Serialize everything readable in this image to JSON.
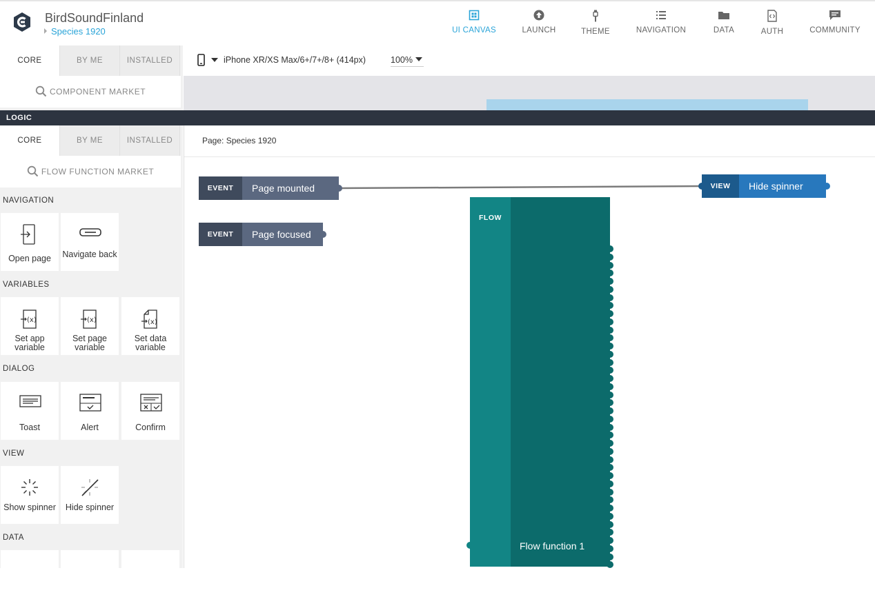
{
  "header": {
    "app_name": "BirdSoundFinland",
    "page_name": "Species 1920",
    "nav": [
      {
        "label": "UI CANVAS",
        "icon": "ui-canvas-icon",
        "active": true
      },
      {
        "label": "LAUNCH",
        "icon": "launch-icon"
      },
      {
        "label": "THEME",
        "icon": "theme-icon"
      },
      {
        "label": "NAVIGATION",
        "icon": "navigation-icon"
      },
      {
        "label": "DATA",
        "icon": "folder-icon"
      },
      {
        "label": "AUTH",
        "icon": "auth-icon"
      },
      {
        "label": "COMMUNITY",
        "icon": "community-icon"
      }
    ]
  },
  "components_panel": {
    "tabs": [
      "CORE",
      "BY ME",
      "INSTALLED"
    ],
    "active_tab": "CORE",
    "market_label": "COMPONENT MARKET"
  },
  "device_bar": {
    "device": "iPhone XR/XS Max/6+/7+/8+ (414px)",
    "zoom": "100%"
  },
  "logic_bar": {
    "label": "LOGIC"
  },
  "logic_panel": {
    "tabs": [
      "CORE",
      "BY ME",
      "INSTALLED"
    ],
    "active_tab": "CORE",
    "market_label": "FLOW FUNCTION MARKET",
    "sections": [
      {
        "label": "NAVIGATION",
        "items": [
          {
            "label": "Open page",
            "icon": "open-page-icon"
          },
          {
            "label": "Navigate back",
            "icon": "navigate-back-icon"
          }
        ]
      },
      {
        "label": "VARIABLES",
        "items": [
          {
            "label": "Set app variable",
            "icon": "set-app-variable-icon"
          },
          {
            "label": "Set page variable",
            "icon": "set-page-variable-icon"
          },
          {
            "label": "Set data variable",
            "icon": "set-data-variable-icon"
          }
        ]
      },
      {
        "label": "DIALOG",
        "items": [
          {
            "label": "Toast",
            "icon": "toast-icon"
          },
          {
            "label": "Alert",
            "icon": "alert-icon"
          },
          {
            "label": "Confirm",
            "icon": "confirm-icon"
          }
        ]
      },
      {
        "label": "VIEW",
        "items": [
          {
            "label": "Show spinner",
            "icon": "show-spinner-icon"
          },
          {
            "label": "Hide spinner",
            "icon": "hide-spinner-icon"
          }
        ]
      },
      {
        "label": "DATA",
        "items": []
      }
    ]
  },
  "logic_canvas": {
    "page_title": "Page: Species 1920",
    "nodes": [
      {
        "kind": "EVENT",
        "name": "Page mounted"
      },
      {
        "kind": "EVENT",
        "name": "Page focused"
      },
      {
        "kind": "VIEW",
        "name": "Hide spinner"
      },
      {
        "kind": "FLOW",
        "name": "Flow function 1"
      }
    ]
  },
  "colors": {
    "accent": "#2aa4d8",
    "event_kind": "#3f4a5c",
    "event_name": "#5b6880",
    "view_kind": "#1c5a8c",
    "view_name": "#2878bd",
    "flow_left": "#128585",
    "flow_right": "#0c6b6b",
    "logic_bar": "#2d3440"
  }
}
